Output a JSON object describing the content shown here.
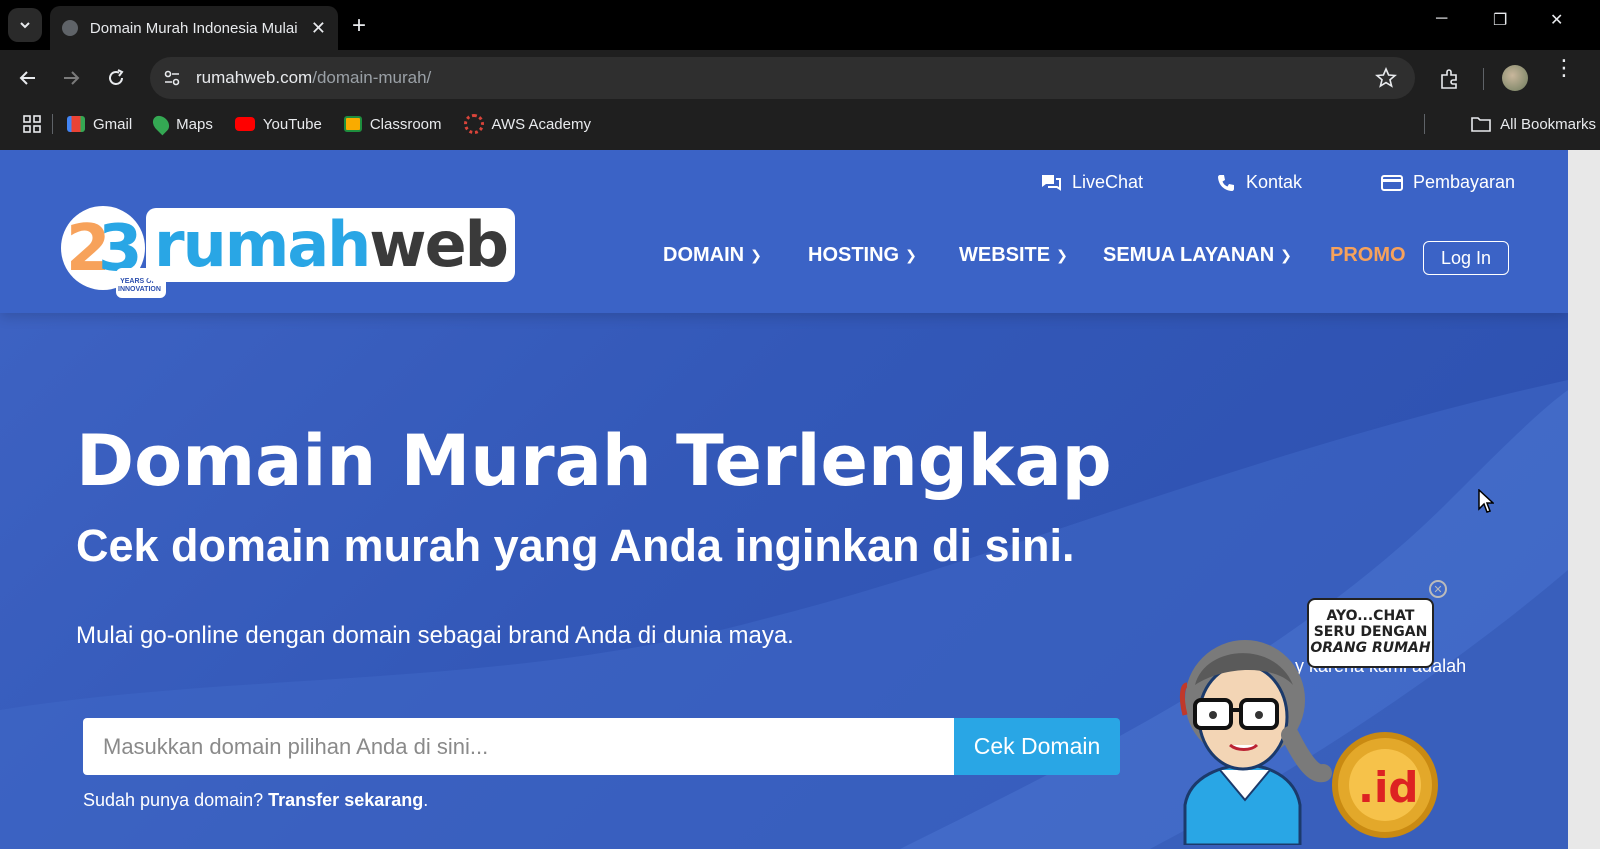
{
  "browser": {
    "tab_title": "Domain Murah Indonesia Mulai",
    "url_host": "rumahweb.com",
    "url_path": "/domain-murah/",
    "bookmarks": [
      {
        "label": "Gmail",
        "color": "#ea4335"
      },
      {
        "label": "Maps",
        "color": "#34a853"
      },
      {
        "label": "YouTube",
        "color": "#ff0000"
      },
      {
        "label": "Classroom",
        "color": "#f9ab00"
      },
      {
        "label": "AWS Academy",
        "color": "#d9443a"
      }
    ],
    "all_bookmarks": "All Bookmarks"
  },
  "header": {
    "top_links": {
      "livechat": "LiveChat",
      "kontak": "Kontak",
      "pembayaran": "Pembayaran"
    },
    "logo": {
      "rumah": "rumah",
      "web": "web",
      "badge_number": "23",
      "badge_text_1": "YEARS OF",
      "badge_text_2": "INNOVATION"
    },
    "nav": {
      "domain": "DOMAIN",
      "hosting": "HOSTING",
      "website": "WEBSITE",
      "semua": "SEMUA LAYANAN",
      "promo": "PROMO",
      "login": "Log In"
    }
  },
  "hero": {
    "title": "Domain Murah Terlengkap",
    "subtitle": "Cek domain murah yang Anda inginkan di sini.",
    "description": "Mulai go-online dengan domain sebagai brand Anda di dunia maya.",
    "search_placeholder": "Masukkan domain pilihan Anda di sini...",
    "search_button": "Cek Domain",
    "transfer_prefix": "Sudah punya domain?",
    "transfer_link": "Transfer sekarang",
    "transfer_suffix": ".",
    "partial_text": "y karena kami adalah"
  },
  "chat_widget": {
    "line1": "AYO...CHAT",
    "line2": "SERU DENGAN",
    "line3": "ORANG RUMAH",
    "badge_text": "id"
  },
  "colors": {
    "brand_blue": "#3b63c6",
    "promo_orange": "#f7a25b",
    "cta_blue": "#29a6e5"
  }
}
